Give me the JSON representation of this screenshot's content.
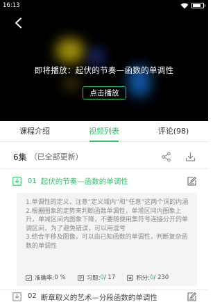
{
  "status_bar": {
    "time": "16:13"
  },
  "video": {
    "upcoming_text": "即将播放：起伏的节奏—函数的单调性",
    "play_label": "点击播放"
  },
  "tabs": [
    {
      "label": "课程介绍"
    },
    {
      "label": "视频列表"
    },
    {
      "label": "评论(98)"
    }
  ],
  "episodes": {
    "count_label": "6集",
    "update_label": "（已全部更新）"
  },
  "lessons": [
    {
      "number": "01",
      "title": "起伏的节奏—函数的单调性",
      "points": [
        "1.单调性的定义，注意“定义域内”和“任意”这两个词的内涵",
        "2.根据图象的走势来判断函数单调性，单增区间内图象上升，单减区间内图象下降，不要随便用集符号连接分开的单调区间，为了避免错误，可以用逗号",
        "3.结合平移及图像，可以由已知函数的单调性，判断复杂函数的单调性"
      ],
      "accuracy_label": "准确率: ",
      "accuracy_value": "0 %",
      "exercise_label": "习题: ",
      "exercise_done": "0",
      "exercise_total": " / 17",
      "points_label": "积分: ",
      "points_done": "0",
      "points_total": " / 230"
    },
    {
      "number": "02",
      "title": "断章取义的艺术—分段函数的单调性"
    }
  ],
  "colors": {
    "accent": "#2ec26a",
    "video_bg": "#000000"
  }
}
